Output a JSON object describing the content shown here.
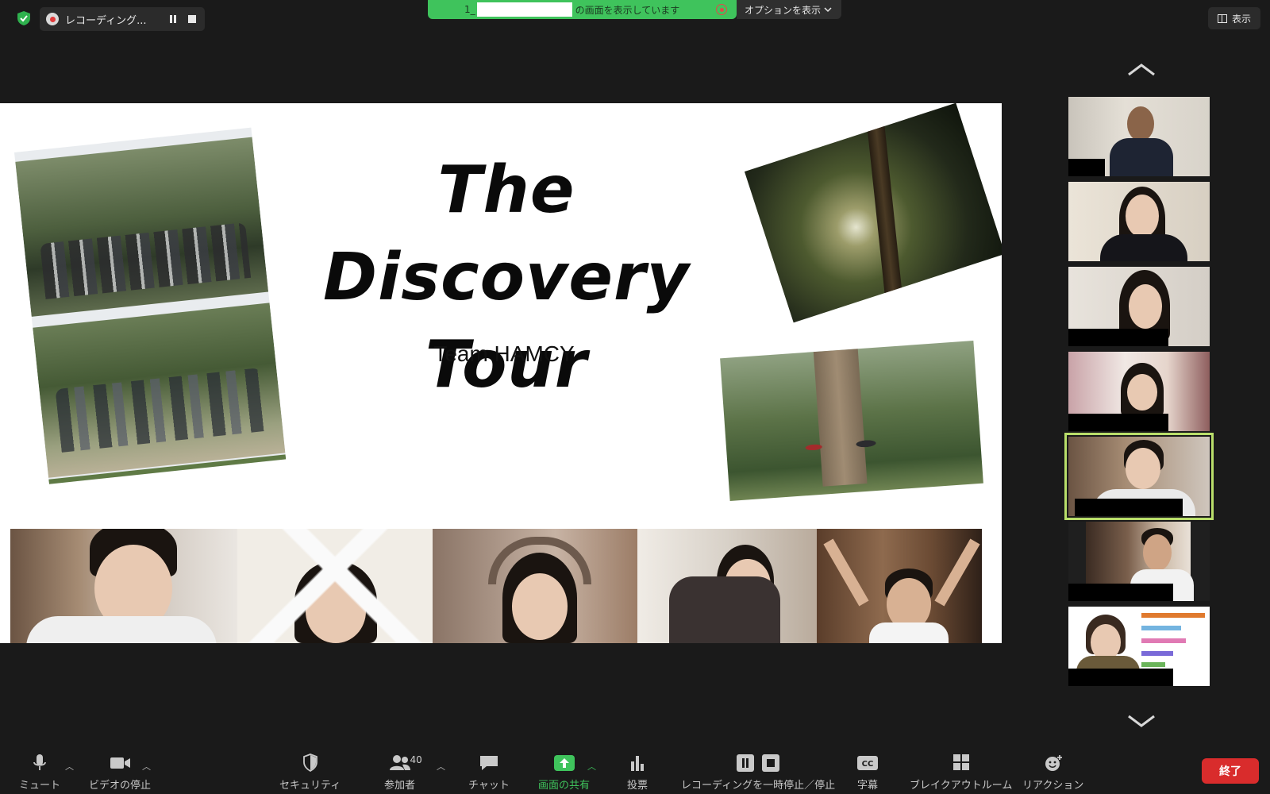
{
  "recording": {
    "label": "レコーディング..."
  },
  "share_banner": {
    "prefix": "1_",
    "suffix": "の画面を表示しています",
    "options_label": "オプションを表示"
  },
  "view_button": {
    "label": "表示"
  },
  "slide": {
    "title_line1": "The Discovery",
    "title_line2": "Tour",
    "subtitle": "Team HAMCY"
  },
  "toolbar": {
    "mute": "ミュート",
    "video": "ビデオの停止",
    "security": "セキュリティ",
    "participants": "参加者",
    "participants_count": "40",
    "chat": "チャット",
    "share": "画面の共有",
    "polls": "投票",
    "record": "レコーディングを一時停止／停止",
    "captions": "字幕",
    "breakout": "ブレイクアウトルーム",
    "reactions": "リアクション",
    "end": "終了"
  },
  "colors": {
    "share_green": "#3fc35c",
    "active_speaker": "#b9de6a",
    "end_red": "#d92c2c",
    "background": "#1a1a1a"
  }
}
